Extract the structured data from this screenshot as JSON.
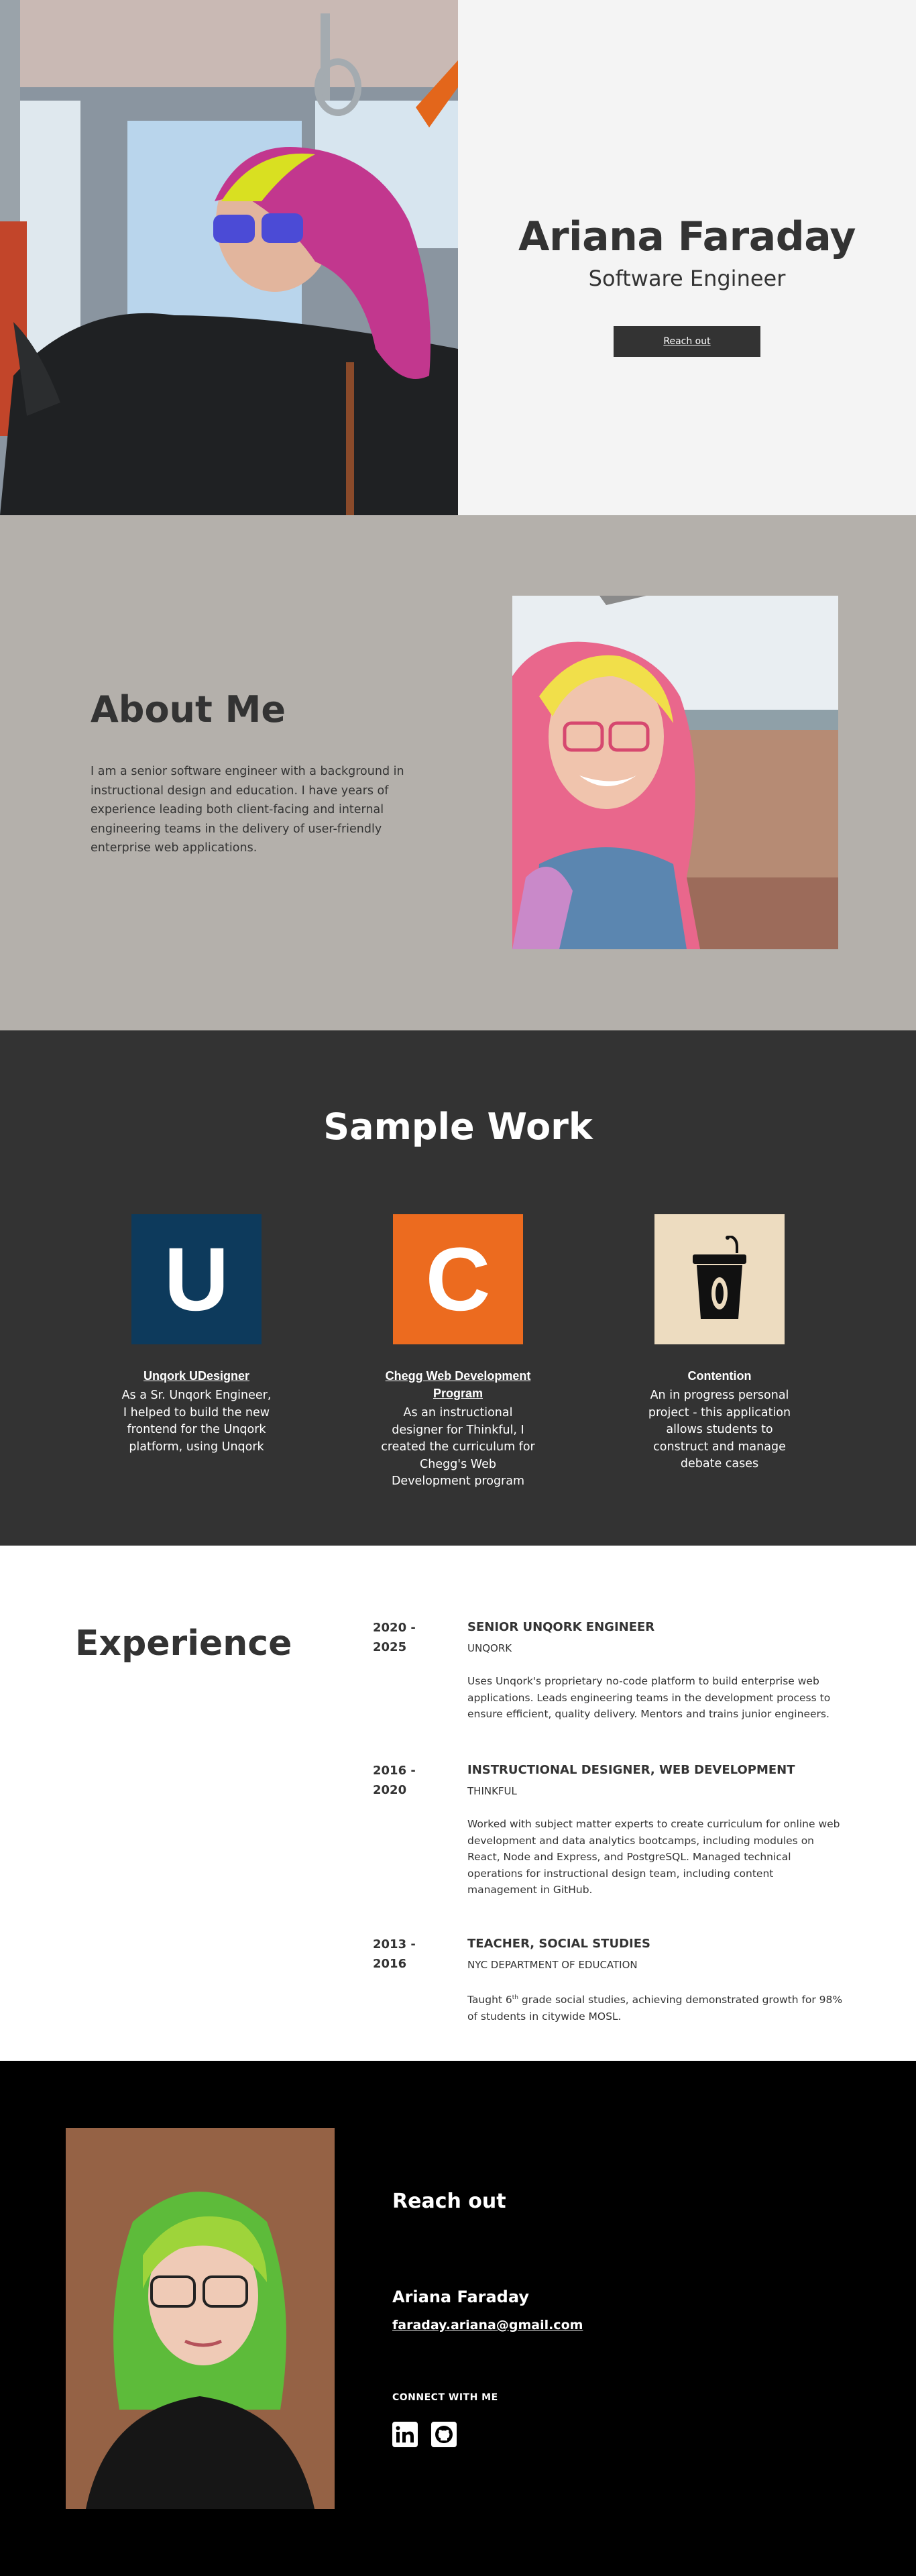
{
  "hero": {
    "name": "Ariana Faraday",
    "role": "Software Engineer",
    "button_label": "Reach out"
  },
  "about": {
    "title": "About Me",
    "body": "I am a senior software engineer with a background in instructional design and education. I have years of experience leading both client-facing and internal engineering teams in the delivery of user-friendly enterprise web applications."
  },
  "work": {
    "title": "Sample Work",
    "items": [
      {
        "tile_letter": "U",
        "tile_color": "#0d3a5c",
        "name": "Unqork UDesigner",
        "description": "As a Sr. Unqork Engineer, I helped to build the new frontend for the Unqork platform, using Unqork"
      },
      {
        "tile_letter": "C",
        "tile_color": "#ec6b1f",
        "name": "Chegg Web Development Program",
        "description": "As an instructional designer for Thinkful, I created the curriculum for Chegg's Web Development program"
      },
      {
        "tile_icon": "podium-icon",
        "tile_color": "#eddcc0",
        "name": "Contention",
        "description": "An in progress personal project - this application allows students to construct and manage debate cases"
      }
    ]
  },
  "experience": {
    "title": "Experience",
    "items": [
      {
        "dates": "2020 - 2025",
        "job": "SENIOR UNQORK ENGINEER",
        "company": "UNQORK",
        "description": "Uses Unqork's proprietary no-code platform to build enterprise web applications. Leads engineering teams in the development process to ensure efficient, quality delivery. Mentors and trains junior engineers."
      },
      {
        "dates": "2016 - 2020",
        "job": "INSTRUCTIONAL DESIGNER, WEB DEVELOPMENT",
        "company": "THINKFUL",
        "description": "Worked with subject matter experts to create curriculum for online web development and data analytics bootcamps, including modules on React, Node and Express, and PostgreSQL. Managed technical operations for instructional design team, including content management in GitHub."
      },
      {
        "dates": "2013 - 2016",
        "job": "TEACHER, SOCIAL STUDIES",
        "company": "NYC DEPARTMENT OF EDUCATION",
        "description_pre": "Taught 6",
        "description_sup": "th",
        "description_post": " grade social studies, achieving demonstrated growth for 98% of students in citywide MOSL."
      }
    ]
  },
  "contact": {
    "title": "Reach out",
    "name": "Ariana Faraday",
    "email": "faraday.ariana@gmail.com",
    "connect_label": "CONNECT WITH ME",
    "social": [
      "linkedin-icon",
      "github-icon"
    ]
  }
}
